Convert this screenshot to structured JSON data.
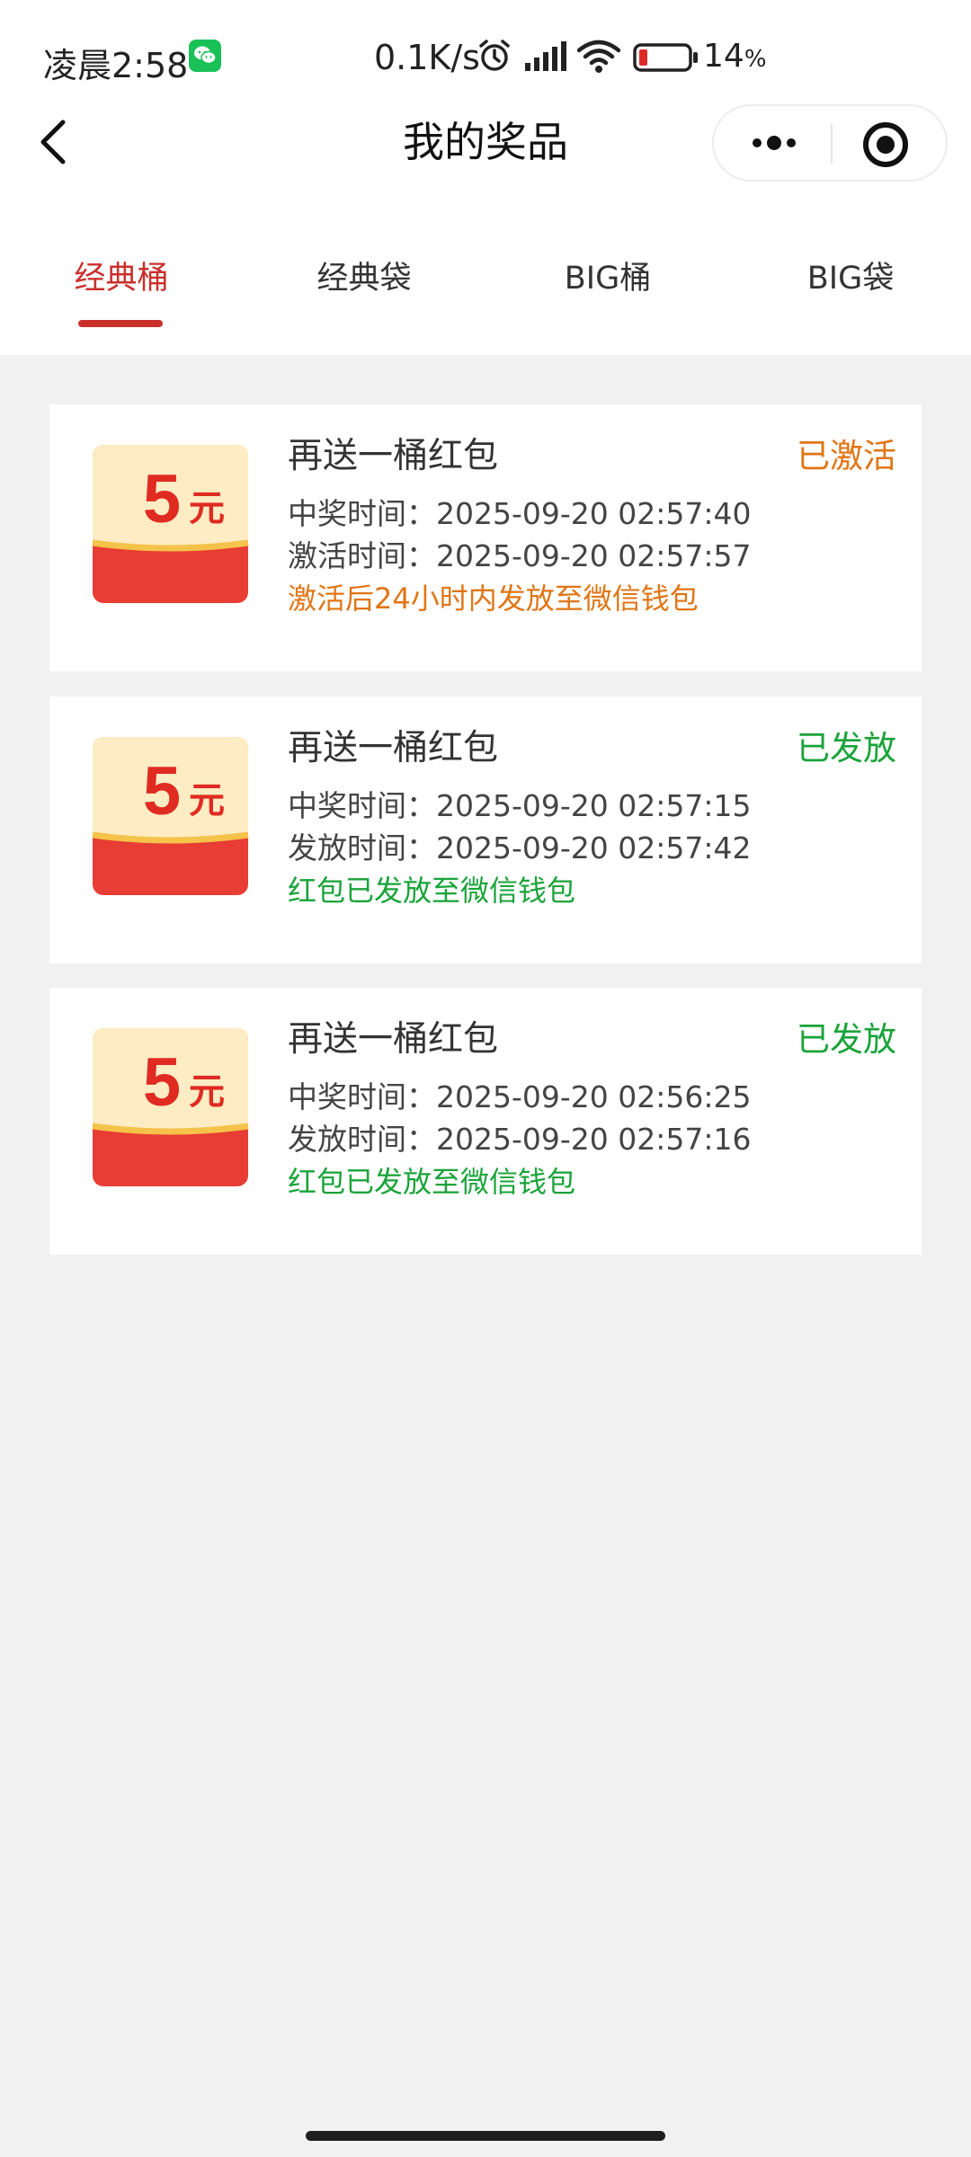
{
  "status_bar": {
    "time": "凌晨2:58",
    "network_speed": "0.1K/s",
    "battery_percent": "14",
    "battery_percent_unit": "%",
    "icons": [
      "wechat-icon",
      "alarm-icon",
      "signal-icon",
      "wifi-icon",
      "battery-icon"
    ]
  },
  "nav": {
    "title": "我的奖品",
    "back_icon": "chevron-left-icon",
    "more_icon": "more-dots-icon",
    "close_icon": "target-close-icon"
  },
  "tabs": [
    {
      "label": "经典桶",
      "active": true
    },
    {
      "label": "经典袋",
      "active": false
    },
    {
      "label": "BIG桶",
      "active": false
    },
    {
      "label": "BIG袋",
      "active": false
    }
  ],
  "prizes": [
    {
      "image_amount": "5",
      "image_unit": "元",
      "title": "再送一桶红包",
      "status": "已激活",
      "line1": "中奖时间：2025-09-20 02:57:40",
      "line2": "激活时间：2025-09-20 02:57:57",
      "note": "激活后24小时内发放至微信钱包"
    },
    {
      "image_amount": "5",
      "image_unit": "元",
      "title": "再送一桶红包",
      "status": "已发放",
      "line1": "中奖时间：2025-09-20 02:57:15",
      "line2": "发放时间：2025-09-20 02:57:42",
      "note": "红包已发放至微信钱包"
    },
    {
      "image_amount": "5",
      "image_unit": "元",
      "title": "再送一桶红包",
      "status": "已发放",
      "line1": "中奖时间：2025-09-20 02:56:25",
      "line2": "发放时间：2025-09-20 02:57:16",
      "note": "红包已发放至微信钱包"
    }
  ],
  "colors": {
    "accent_red": "#c9302c",
    "status_orange": "#e17515",
    "status_green": "#1aa33a",
    "page_background": "#f1f1f1",
    "card_background": "#ffffff"
  }
}
